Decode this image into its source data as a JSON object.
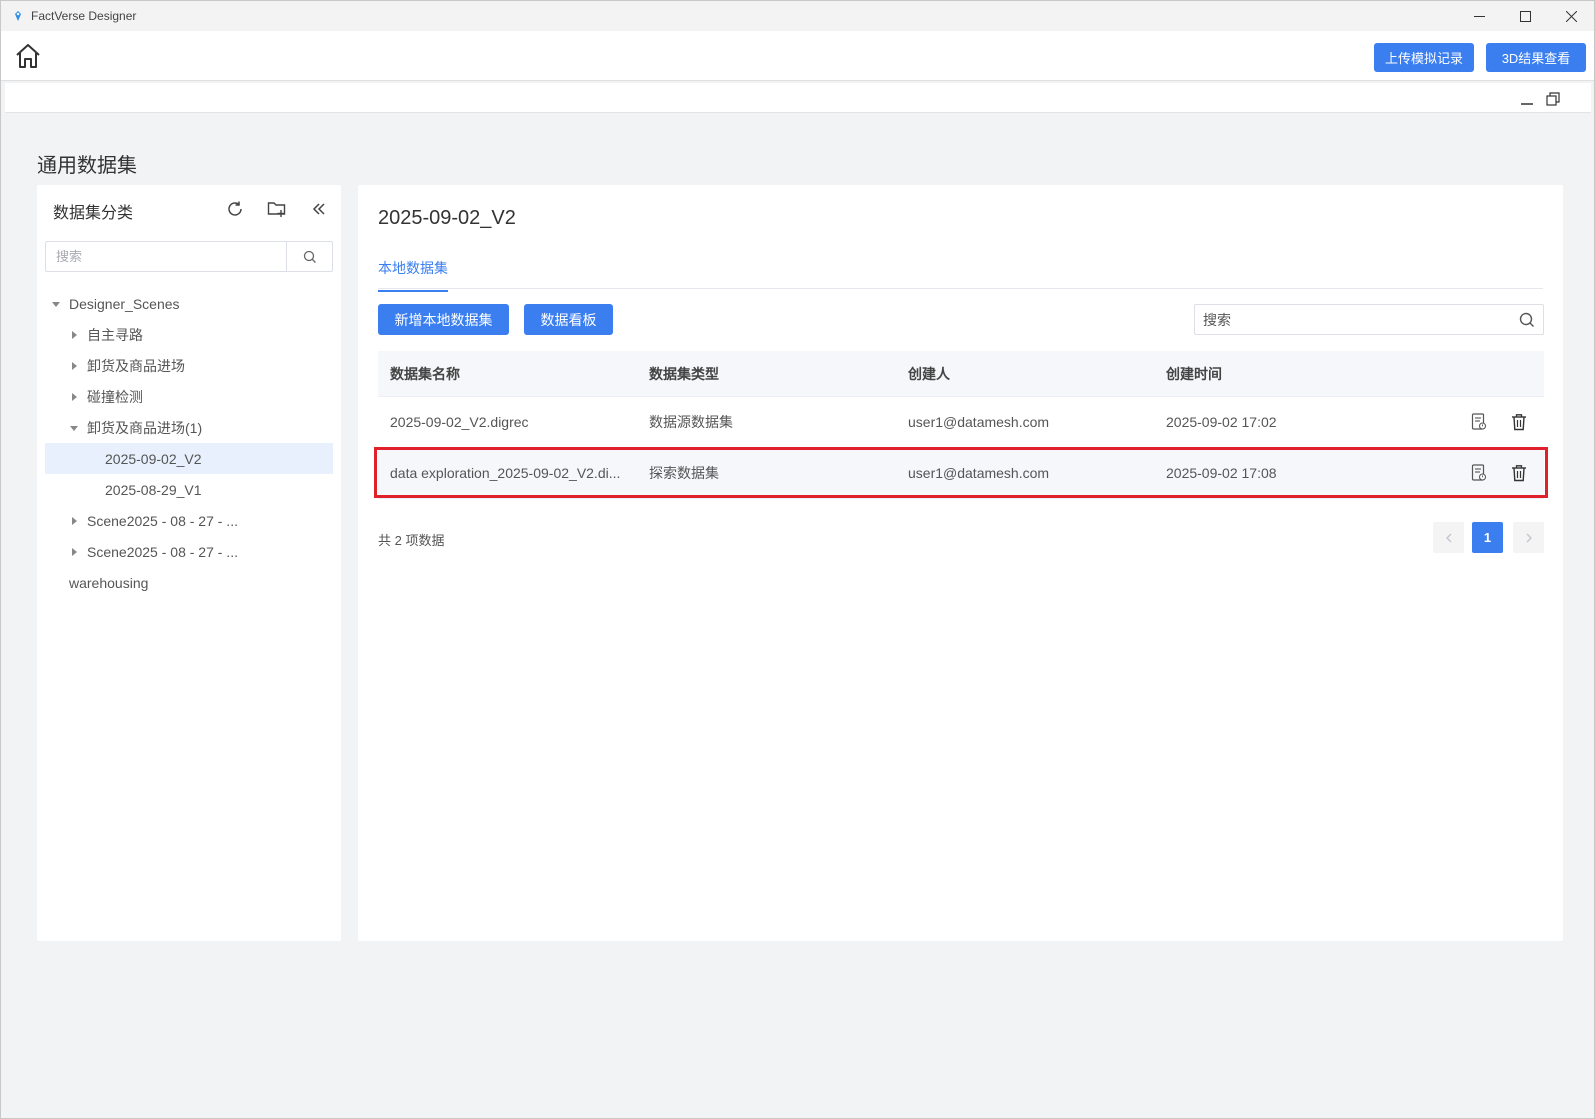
{
  "window": {
    "title": "FactVerse Designer"
  },
  "header": {
    "upload_label": "上传模拟记录",
    "view3d_label": "3D结果查看"
  },
  "page": {
    "title": "通用数据集"
  },
  "sidebar": {
    "title": "数据集分类",
    "search_placeholder": "搜索",
    "tree": [
      {
        "label": "Designer_Scenes",
        "expanded": true
      },
      {
        "label": "自主寻路"
      },
      {
        "label": "卸货及商品进场"
      },
      {
        "label": "碰撞检测"
      },
      {
        "label": "卸货及商品进场(1)",
        "expanded": true
      },
      {
        "label": "2025-09-02_V2",
        "selected": true
      },
      {
        "label": "2025-08-29_V1"
      },
      {
        "label": "Scene2025 - 08 - 27 - ..."
      },
      {
        "label": "Scene2025 - 08 - 27 - ..."
      },
      {
        "label": "warehousing"
      }
    ]
  },
  "main": {
    "title": "2025-09-02_V2",
    "tab_label": "本地数据集",
    "new_button": "新增本地数据集",
    "board_button": "数据看板",
    "search_placeholder": "搜索",
    "columns": [
      "数据集名称",
      "数据集类型",
      "创建人",
      "创建时间"
    ],
    "rows": [
      {
        "name": "2025-09-02_V2.digrec",
        "type": "数据源数据集",
        "creator": "user1@datamesh.com",
        "time": "2025-09-02 17:02"
      },
      {
        "name": "data exploration_2025-09-02_V2.di...",
        "type": "探索数据集",
        "creator": "user1@datamesh.com",
        "time": "2025-09-02 17:08"
      }
    ],
    "total_text": "共 2 项数据",
    "current_page": "1"
  },
  "colors": {
    "accent": "#3a7ef0",
    "highlight": "#e0202a"
  }
}
